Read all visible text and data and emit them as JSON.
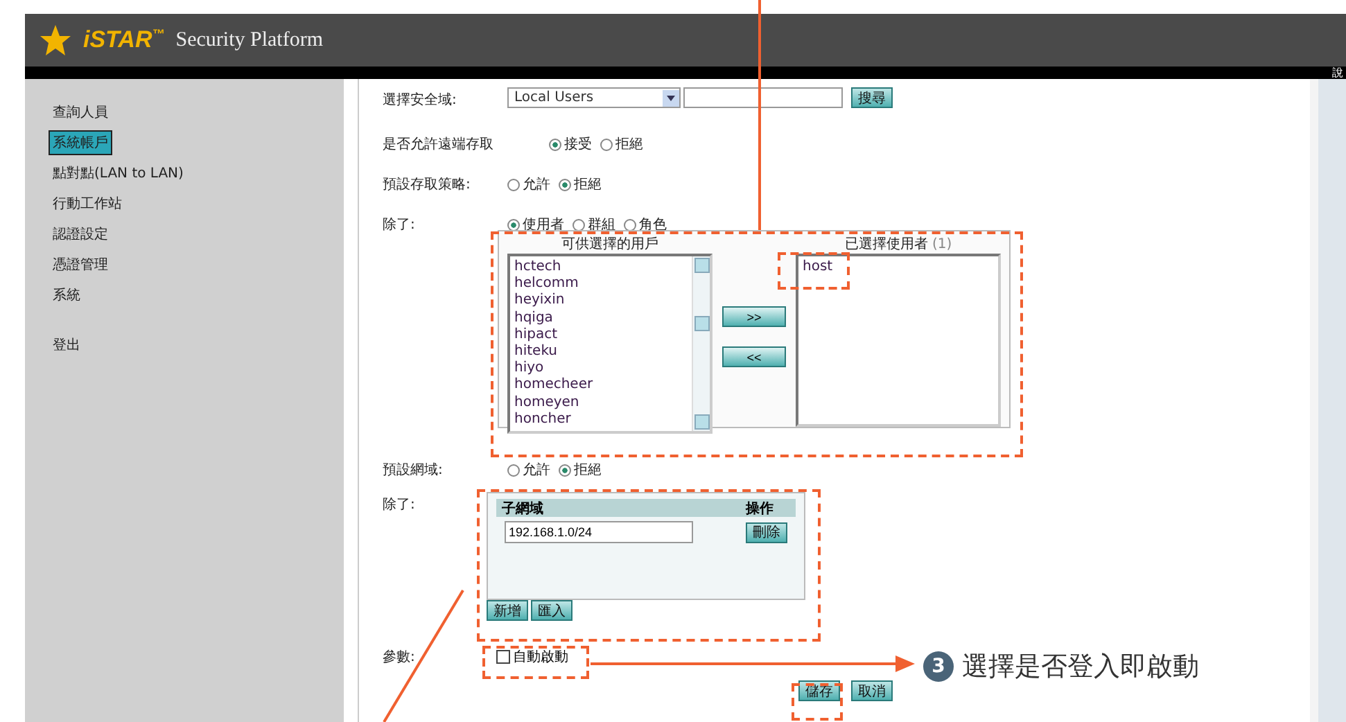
{
  "header": {
    "logo": "iSTAR",
    "trademark": "™",
    "title": "Security Platform",
    "corner": "說"
  },
  "sidebar": {
    "items": [
      {
        "label": "查詢人員",
        "selected": false
      },
      {
        "label": "系統帳戶",
        "selected": true
      },
      {
        "label": "點對點(LAN to LAN)",
        "selected": false
      },
      {
        "label": "行動工作站",
        "selected": false
      },
      {
        "label": "認證設定",
        "selected": false
      },
      {
        "label": "憑證管理",
        "selected": false
      },
      {
        "label": "系統",
        "selected": false
      },
      {
        "label": "登出",
        "selected": false
      }
    ]
  },
  "form": {
    "domain": {
      "label": "選擇安全域:",
      "select": "Local Users",
      "search_button": "搜尋"
    },
    "remote": {
      "label": "是否允許遠端存取",
      "options": [
        {
          "label": "接受",
          "selected": true
        },
        {
          "label": "拒絕",
          "selected": false
        }
      ]
    },
    "policy": {
      "label": "預設存取策略:",
      "options": [
        {
          "label": "允許",
          "selected": false
        },
        {
          "label": "拒絕",
          "selected": true
        }
      ]
    },
    "except_users": {
      "label": "除了:",
      "options": [
        {
          "label": "使用者",
          "selected": true
        },
        {
          "label": "群組",
          "selected": false
        },
        {
          "label": "角色",
          "selected": false
        }
      ]
    },
    "available": {
      "title": "可供選擇的用戶",
      "items": [
        "hctech",
        "helcomm",
        "heyixin",
        "hqiga",
        "hipact",
        "hiteku",
        "hiyo",
        "homecheer",
        "homeyen",
        "honcher"
      ]
    },
    "chosen": {
      "title": "已選擇使用者",
      "count": "(1)",
      "items": [
        "host"
      ]
    },
    "move_buttons": [
      ">>",
      "<<"
    ],
    "network": {
      "label": "預設網域:",
      "options": [
        {
          "label": "允許",
          "selected": false
        },
        {
          "label": "拒絕",
          "selected": true
        }
      ]
    },
    "except_networks": {
      "label": "除了:",
      "columns": [
        "子網域",
        "操作"
      ],
      "rows": [
        {
          "value": "192.168.1.0/24",
          "action": "刪除"
        }
      ],
      "buttons": [
        "新增",
        "匯入"
      ]
    },
    "params": {
      "label": "參數:",
      "checkbox": {
        "label": "自動啟動",
        "checked": false
      }
    },
    "actions": [
      "儲存",
      "取消"
    ]
  },
  "callout": {
    "number": "3",
    "text": "選擇是否登入即啟動"
  }
}
